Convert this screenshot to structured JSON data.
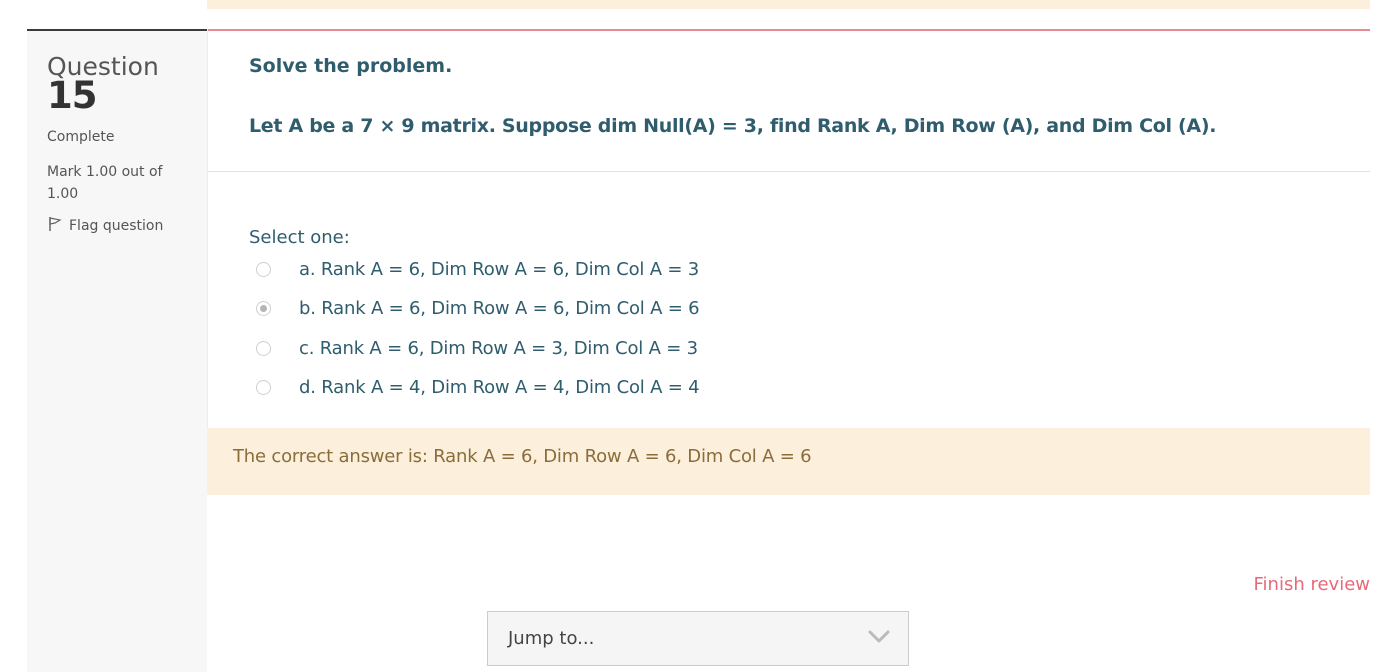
{
  "info": {
    "question_label": "Question",
    "question_number": "15",
    "state": "Complete",
    "mark": "Mark 1.00 out of 1.00",
    "flag_label": "Flag question",
    "flag_icon": "flag-icon"
  },
  "question": {
    "instruction": "Solve the problem.",
    "text": "Let A be a 7 × 9 matrix. Suppose dim Null(A) = 3, find Rank A, Dim Row (A), and Dim Col (A).",
    "select_label": "Select one:",
    "options": [
      {
        "label": "a. Rank A = 6, Dim Row A = 6, Dim Col A = 3",
        "selected": false
      },
      {
        "label": "b. Rank A = 6, Dim Row A = 6, Dim Col A = 6",
        "selected": true
      },
      {
        "label": "c. Rank A = 6, Dim Row A = 3, Dim Col A = 3",
        "selected": false
      },
      {
        "label": "d. Rank A = 4, Dim Row A = 4, Dim Col A = 4",
        "selected": false
      }
    ]
  },
  "feedback": {
    "text": "The correct answer is: Rank A = 6, Dim Row A = 6, Dim Col A = 6"
  },
  "navigation": {
    "finish_review": "Finish review",
    "jump_placeholder": "Jump to...",
    "jump_icon": "chevron-down-icon"
  },
  "colors": {
    "question_text": "#2f5d6d",
    "feedback_bg": "#fcefdc",
    "feedback_text": "#8a6d3b",
    "accent_red": "#e8697a"
  }
}
